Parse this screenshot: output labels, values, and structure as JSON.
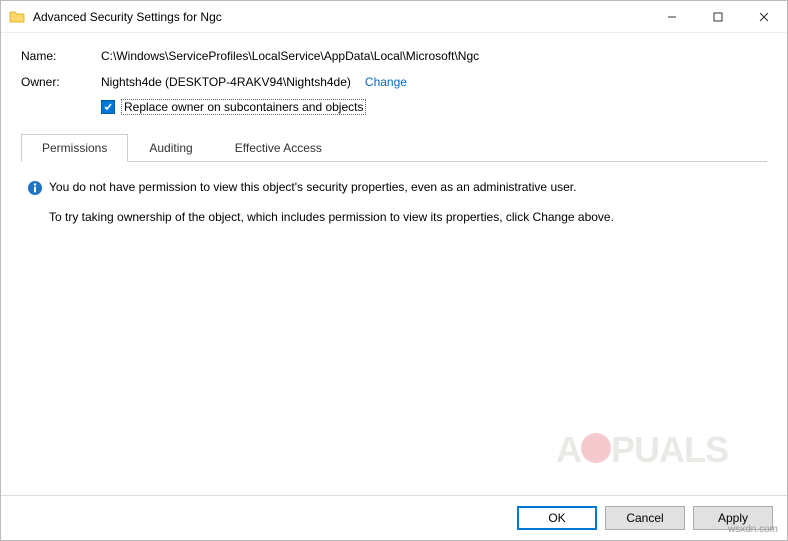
{
  "window": {
    "title": "Advanced Security Settings for Ngc"
  },
  "fields": {
    "name_label": "Name:",
    "name_value": "C:\\Windows\\ServiceProfiles\\LocalService\\AppData\\Local\\Microsoft\\Ngc",
    "owner_label": "Owner:",
    "owner_value": "Nightsh4de (DESKTOP-4RAKV94\\Nightsh4de)",
    "change_link": "Change",
    "replace_owner_label": "Replace owner on subcontainers and objects"
  },
  "tabs": {
    "permissions": "Permissions",
    "auditing": "Auditing",
    "effective": "Effective Access"
  },
  "message": {
    "line1": "You do not have permission to view this object's security properties, even as an administrative user.",
    "line2": "To try taking ownership of the object, which includes permission to view its properties, click Change above."
  },
  "buttons": {
    "ok": "OK",
    "cancel": "Cancel",
    "apply": "Apply"
  },
  "watermark": {
    "text_prefix": "A",
    "text_suffix": "PUALS",
    "credit": "wsxdn.com"
  }
}
